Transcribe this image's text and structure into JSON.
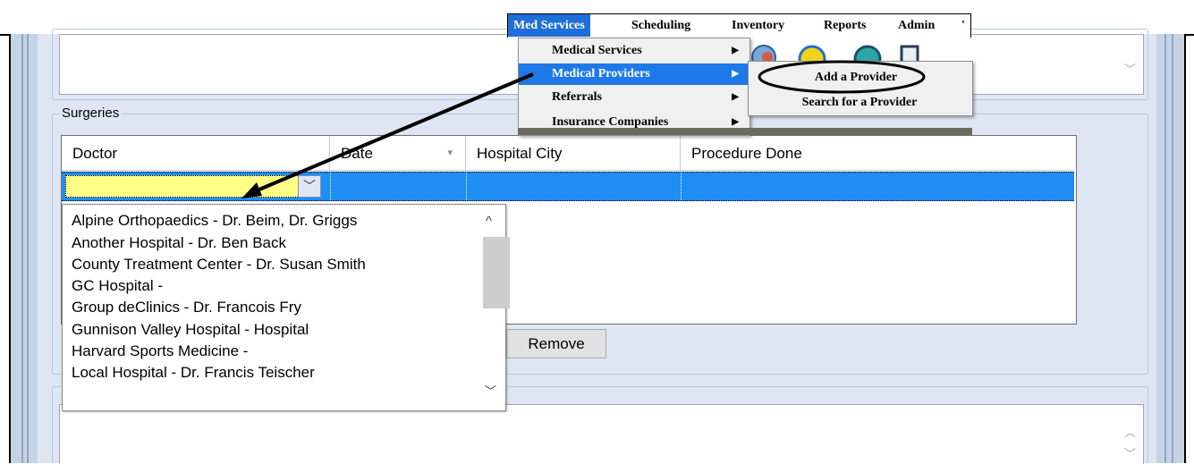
{
  "menubar": {
    "items": [
      {
        "label": "Med Services",
        "active": true
      },
      {
        "label": "Scheduling",
        "active": false
      },
      {
        "label": "Inventory",
        "active": false
      },
      {
        "label": "Reports",
        "active": false
      },
      {
        "label": "Admin",
        "active": false
      }
    ]
  },
  "med_services_menu": {
    "items": [
      {
        "label": "Medical Services",
        "active": false
      },
      {
        "label": "Medical Providers",
        "active": true
      },
      {
        "label": "Referrals",
        "active": false
      },
      {
        "label": "Insurance Companies",
        "active": false
      }
    ]
  },
  "providers_submenu": {
    "items": [
      {
        "label": "Add a Provider",
        "highlighted": true
      },
      {
        "label": "Search for a Provider",
        "highlighted": false
      }
    ]
  },
  "surgeries": {
    "label": "Surgeries",
    "columns": [
      "Doctor",
      "Date",
      "Hospital City",
      "Procedure Done"
    ],
    "remove_label": "Remove"
  },
  "doctor_dropdown": {
    "options": [
      "Alpine Orthopaedics - Dr. Beim, Dr. Griggs",
      "Another Hospital - Dr. Ben Back",
      "County Treatment Center - Dr. Susan Smith",
      "GC Hospital -",
      "Group deClinics - Dr. Francois Fry",
      "Gunnison Valley Hospital - Hospital",
      "Harvard Sports Medicine -",
      "Local Hospital - Dr. Francis Teischer"
    ]
  },
  "colors": {
    "menu_active": "#1f6fd8",
    "row_selected": "#1e8df4",
    "cell_edit": "#ffff88",
    "panel": "#dde6f2"
  }
}
